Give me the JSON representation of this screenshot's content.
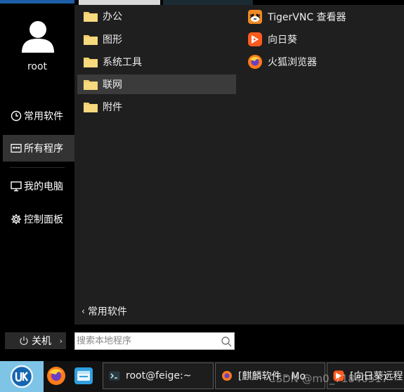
{
  "user": {
    "name": "root"
  },
  "sidebar": {
    "items": [
      {
        "label": "常用软件",
        "icon": "clock-icon"
      },
      {
        "label": "所有程序",
        "icon": "grid-icon"
      },
      {
        "label": "我的电脑",
        "icon": "monitor-icon"
      },
      {
        "label": "控制面板",
        "icon": "gear-icon"
      }
    ]
  },
  "categories": [
    {
      "label": "办公",
      "icon": "folder-icon"
    },
    {
      "label": "图形",
      "icon": "folder-icon"
    },
    {
      "label": "系统工具",
      "icon": "folder-icon"
    },
    {
      "label": "联网",
      "icon": "folder-icon"
    },
    {
      "label": "附件",
      "icon": "folder-icon"
    }
  ],
  "apps": [
    {
      "label": "TigerVNC 查看器",
      "icon": "tigervnc-icon"
    },
    {
      "label": "向日葵",
      "icon": "sunlogin-icon"
    },
    {
      "label": "火狐浏览器",
      "icon": "firefox-icon"
    }
  ],
  "back": {
    "label": "常用软件"
  },
  "power": {
    "label": "关机"
  },
  "search": {
    "placeholder": "搜索本地程序"
  },
  "taskbar": {
    "tasks": [
      {
        "label": "root@feige:~",
        "icon": "terminal-icon"
      },
      {
        "label": "[麒麟软件 - Mo",
        "icon": "firefox-icon"
      },
      {
        "label": "[向日葵远程",
        "icon": "sunlogin-icon"
      }
    ]
  },
  "watermark": "CSDN @m0_71840517",
  "colors": {
    "folder": "#f3cf6a",
    "start_button": "#7dc4e6",
    "panel_bg": "#1f1f1f",
    "active_item": "#333333"
  }
}
